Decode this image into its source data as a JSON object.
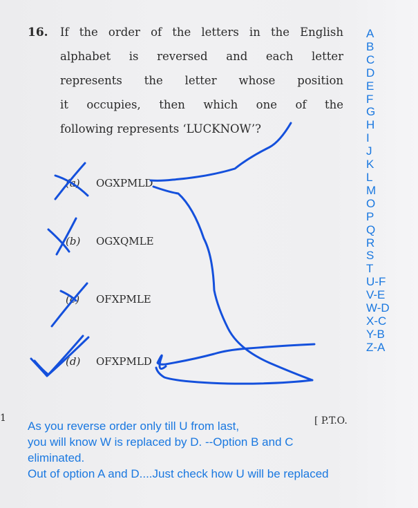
{
  "question": {
    "number": "16.",
    "lines": [
      "If the order of the letters in the English",
      "alphabet is reversed and each letter",
      "represents the letter whose position",
      "it occupies, then which one of the",
      "following represents ‘LUCKNOW’?"
    ],
    "options": [
      {
        "label": "(a)",
        "text": "OGXPMLD",
        "mark": "cross"
      },
      {
        "label": "(b)",
        "text": "OGXQMLE",
        "mark": "cross"
      },
      {
        "label": "(c)",
        "text": "OFXPMLE",
        "mark": "cross"
      },
      {
        "label": "(d)",
        "text": "OFXPMLD",
        "mark": "tick"
      }
    ]
  },
  "page_footer": {
    "pto": "[ P.T.O.",
    "page_mark": "1"
  },
  "annotations": {
    "alphabet_column": [
      "A",
      "B",
      "C",
      "D",
      "E",
      "F",
      "G",
      "H",
      "I",
      "J",
      "K",
      "L",
      "M",
      "O",
      "P",
      "Q",
      "R",
      "S",
      "T",
      "U-F",
      "V-E",
      "W-D",
      "X-C",
      "Y-B",
      "Z-A"
    ],
    "note_lines": [
      "As you reverse order only till U from last,",
      "you will know W is replaced by D. --Option B and C",
      "eliminated.",
      "Out of option A and D....Just check how U will be replaced"
    ],
    "ink_color": "#1450dc",
    "text_color": "#1a78e0"
  }
}
